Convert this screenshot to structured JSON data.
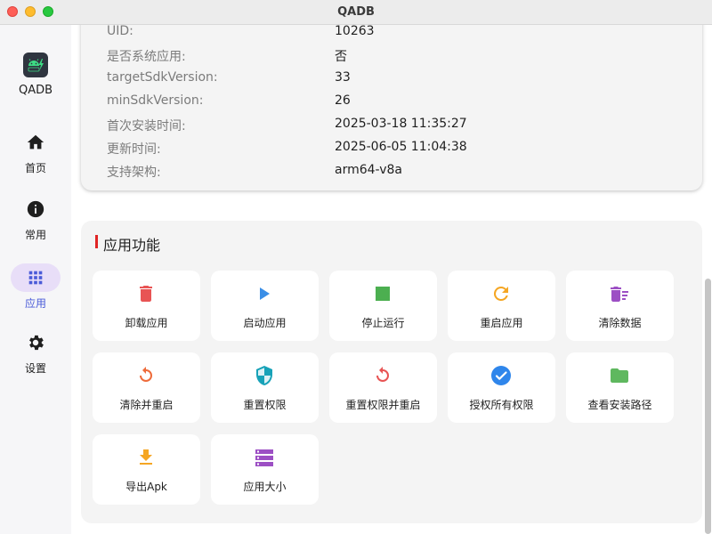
{
  "window": {
    "title": "QADB"
  },
  "sidebar": {
    "app_name": "QADB",
    "items": [
      {
        "label": "首页",
        "icon": "home-icon",
        "active": false
      },
      {
        "label": "常用",
        "icon": "info-icon",
        "active": false
      },
      {
        "label": "应用",
        "icon": "apps-grid-icon",
        "active": true
      },
      {
        "label": "设置",
        "icon": "gear-icon",
        "active": false
      }
    ]
  },
  "info": {
    "rows": [
      {
        "label": "UID:",
        "value": "10263"
      },
      {
        "label": "是否系统应用:",
        "value": "否"
      },
      {
        "label": "targetSdkVersion:",
        "value": "33"
      },
      {
        "label": "minSdkVersion:",
        "value": "26"
      },
      {
        "label": "首次安装时间:",
        "value": "2025-03-18 11:35:27"
      },
      {
        "label": "更新时间:",
        "value": "2025-06-05 11:04:38"
      },
      {
        "label": "支持架构:",
        "value": "arm64-v8a"
      }
    ]
  },
  "functions": {
    "title": "应用功能",
    "buttons": [
      {
        "label": "卸载应用",
        "icon": "trash-icon",
        "color": "#e85454"
      },
      {
        "label": "启动应用",
        "icon": "play-icon",
        "color": "#3a8ee6"
      },
      {
        "label": "停止运行",
        "icon": "stop-icon",
        "color": "#4caf50"
      },
      {
        "label": "重启应用",
        "icon": "restart-icon",
        "color": "#f5a623"
      },
      {
        "label": "清除数据",
        "icon": "clear-data-icon",
        "color": "#9c4fc4"
      },
      {
        "label": "清除并重启",
        "icon": "clear-restart-icon",
        "color": "#ee6b3a"
      },
      {
        "label": "重置权限",
        "icon": "shield-icon",
        "color": "#17a2b8"
      },
      {
        "label": "重置权限并重启",
        "icon": "reset-restart-icon",
        "color": "#e85454"
      },
      {
        "label": "授权所有权限",
        "icon": "check-circle-icon",
        "color": "#2f86eb"
      },
      {
        "label": "查看安装路径",
        "icon": "folder-icon",
        "color": "#5fb85f"
      },
      {
        "label": "导出Apk",
        "icon": "download-icon",
        "color": "#f5a623"
      },
      {
        "label": "应用大小",
        "icon": "storage-icon",
        "color": "#9c4fc4"
      }
    ]
  },
  "colors": {
    "accent": "#4a5bd8",
    "active_nav_bg": "#e8def8",
    "title_marker": "#e02424"
  }
}
